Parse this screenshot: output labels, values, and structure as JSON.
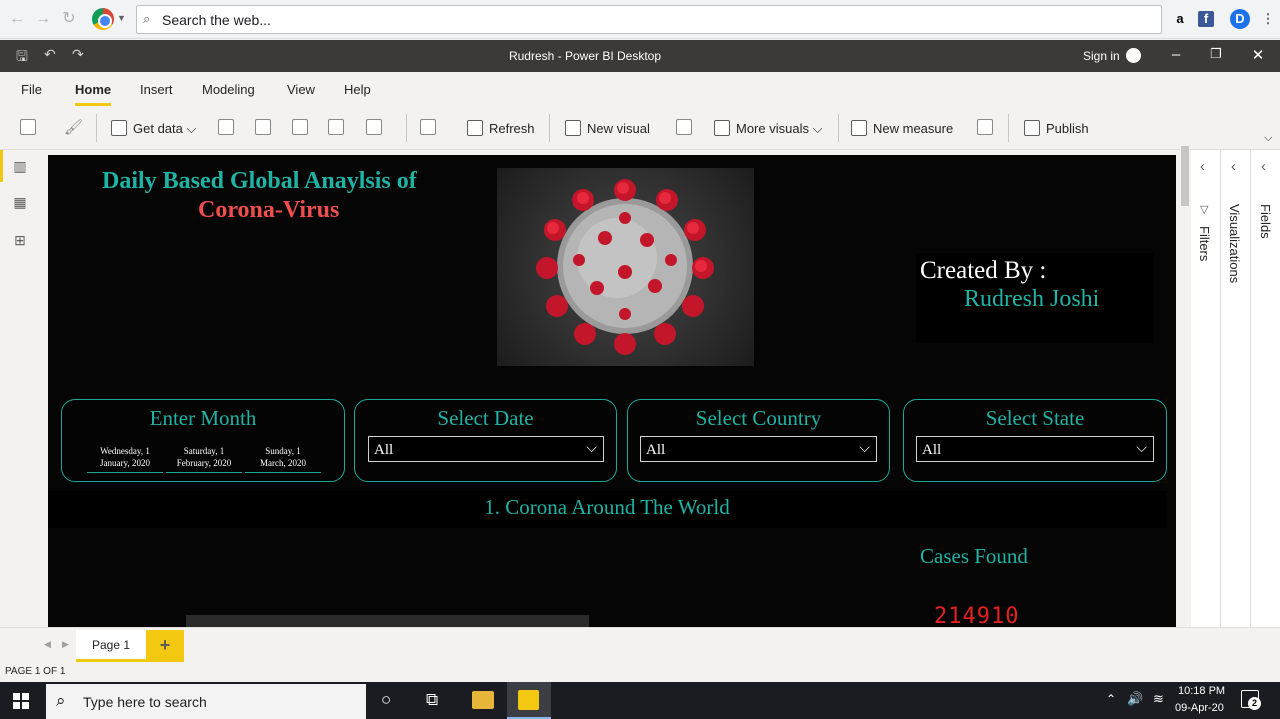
{
  "browser": {
    "search_placeholder": "Search the web...",
    "ext_amazon": "a",
    "ext_fb": "f",
    "ext_d": "D"
  },
  "window": {
    "title": "Rudresh - Power BI Desktop",
    "sign_in": "Sign in"
  },
  "tabs": [
    "File",
    "Home",
    "Insert",
    "Modeling",
    "View",
    "Help"
  ],
  "ribbon": {
    "get_data": "Get data",
    "refresh": "Refresh",
    "new_visual": "New visual",
    "more_visuals": "More visuals",
    "new_measure": "New measure",
    "publish": "Publish"
  },
  "report": {
    "title_line1": "Daily Based Global Anaylsis of",
    "title_line2": "Corona-Virus",
    "created_by_label": "Created By :",
    "creator_name": "Rudresh Joshi",
    "slicers": {
      "month": {
        "title": "Enter Month",
        "options": [
          {
            "line1": "Wednesday, 1",
            "line2": "January, 2020"
          },
          {
            "line1": "Saturday, 1",
            "line2": "February, 2020"
          },
          {
            "line1": "Sunday, 1",
            "line2": "March, 2020"
          }
        ]
      },
      "date": {
        "title": "Select Date",
        "value": "All"
      },
      "country": {
        "title": "Select Country",
        "value": "All"
      },
      "state": {
        "title": "Select State",
        "value": "All"
      }
    },
    "section_title": "1. Corona Around The World",
    "cases_label": "Cases Found",
    "cases_value": "214910"
  },
  "panes": {
    "filters": "Filters",
    "visualizations": "Visualizations",
    "fields": "Fields"
  },
  "pages": {
    "current": "Page 1",
    "add": "+",
    "status": "PAGE 1 OF 1"
  },
  "taskbar": {
    "search_placeholder": "Type here to search",
    "time": "10:18 PM",
    "date": "09-Apr-20",
    "notifications": "2"
  },
  "colors": {
    "accent": "#f2c811",
    "teal": "#1fb3a5",
    "red": "#f04e4e",
    "canvas": "#050505"
  }
}
